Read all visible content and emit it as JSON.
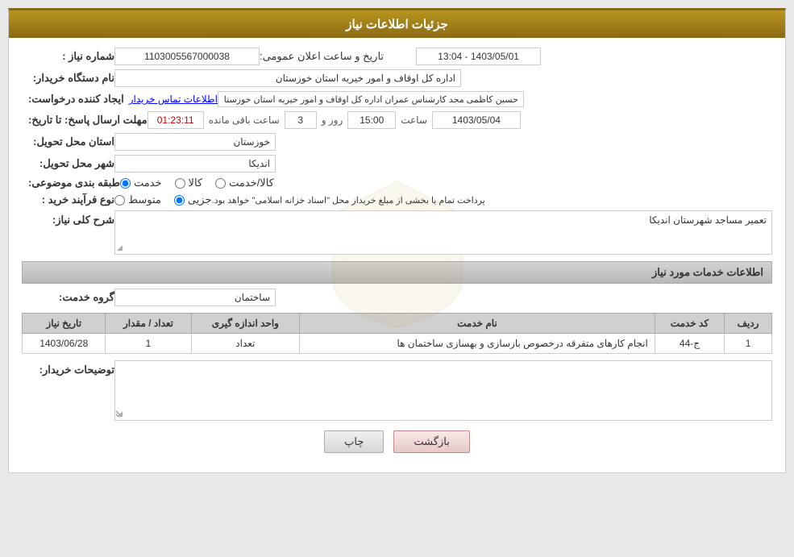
{
  "header": {
    "title": "جزئیات اطلاعات نیاز"
  },
  "fields": {
    "order_number_label": "شماره نیاز :",
    "order_number_value": "1103005567000038",
    "announcement_date_label": "تاریخ و ساعت اعلان عمومی:",
    "announcement_date_value": "1403/05/01 - 13:04",
    "buyer_org_label": "نام دستگاه خریدار:",
    "buyer_org_value": "اداره کل اوقاف و امور خیریه استان خوزستان",
    "creator_label": "ایجاد کننده درخواست:",
    "creator_value": "حسین کاظمی مجد کارشناس عمران اداره کل اوقاف و امور خیریه استان خوزستان",
    "creator_link": "اطلاعات تماس خریدار",
    "response_deadline_label": "مهلت ارسال پاسخ: تا تاریخ:",
    "deadline_date": "1403/05/04",
    "deadline_time_label": "ساعت",
    "deadline_time": "15:00",
    "deadline_day_label": "روز و",
    "deadline_days": "3",
    "deadline_remaining_label": "ساعت باقی مانده",
    "deadline_remaining": "01:23:11",
    "province_label": "استان محل تحویل:",
    "province_value": "خوزستان",
    "city_label": "شهر محل تحویل:",
    "city_value": "اندیکا",
    "category_label": "طبقه بندی موضوعی:",
    "category_options": [
      "کالا",
      "خدمت",
      "کالا/خدمت"
    ],
    "category_selected": "خدمت",
    "process_label": "نوع فرآیند خرید :",
    "process_options": [
      "جزیی",
      "متوسط"
    ],
    "process_note": "پرداخت تمام یا بخشی از مبلغ خریداز محل \"اسناد خزانه اسلامی\" خواهد بود.",
    "description_label": "شرح کلی نیاز:",
    "description_value": "تعمیر مساجد شهرستان اندیکا",
    "services_section_title": "اطلاعات خدمات مورد نیاز",
    "group_label": "گروه خدمت:",
    "group_value": "ساختمان",
    "table_headers": [
      "ردیف",
      "کد خدمت",
      "نام خدمت",
      "واحد اندازه گیری",
      "تعداد / مقدار",
      "تاریخ نیاز"
    ],
    "table_rows": [
      {
        "row": "1",
        "code": "ج-44",
        "name": "انجام کارهای متفرقه درخصوص بازسازی و بهسازی ساختمان ها",
        "unit": "تعداد",
        "quantity": "1",
        "date": "1403/06/28"
      }
    ],
    "buyer_notes_label": "توضیحات خریدار:",
    "buyer_notes_value": "",
    "btn_print": "چاپ",
    "btn_back": "بازگشت"
  }
}
